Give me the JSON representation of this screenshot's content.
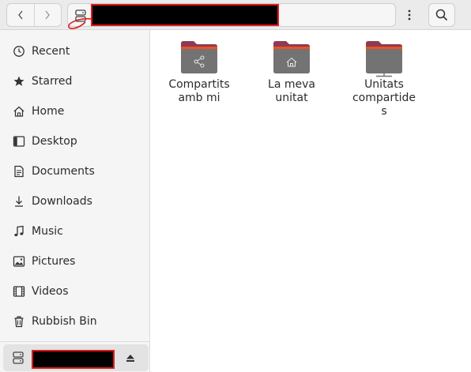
{
  "header": {
    "back_icon": "chevron-left-icon",
    "forward_icon": "chevron-right-icon",
    "location_icon": "drive-icon",
    "path_current": "",
    "menu_icon": "kebab-menu-icon",
    "search_icon": "search-icon"
  },
  "sidebar": {
    "items": [
      {
        "label": "Recent",
        "icon": "clock-icon"
      },
      {
        "label": "Starred",
        "icon": "star-icon"
      },
      {
        "label": "Home",
        "icon": "home-icon"
      },
      {
        "label": "Desktop",
        "icon": "desktop-icon"
      },
      {
        "label": "Documents",
        "icon": "document-icon"
      },
      {
        "label": "Downloads",
        "icon": "download-icon"
      },
      {
        "label": "Music",
        "icon": "music-icon"
      },
      {
        "label": "Pictures",
        "icon": "picture-icon"
      },
      {
        "label": "Videos",
        "icon": "video-icon"
      },
      {
        "label": "Rubbish Bin",
        "icon": "trash-icon"
      }
    ],
    "mounted_drive": {
      "label": "",
      "icon": "drive-icon",
      "eject_icon": "eject-icon"
    }
  },
  "main": {
    "folders": [
      {
        "line1": "Compartits",
        "line2": "amb mi",
        "line3": "",
        "emblem": "share-icon"
      },
      {
        "line1": "La meva",
        "line2": "unitat",
        "line3": "",
        "emblem": "home-icon"
      },
      {
        "line1": "Unitats",
        "line2": "compartide",
        "line3": "s",
        "emblem": "network-icon"
      }
    ]
  },
  "colors": {
    "folder_tab": "#e95420",
    "folder_tab_dark": "#8f3a55",
    "folder_body": "#737373",
    "redaction_outline": "#e01b1b"
  }
}
